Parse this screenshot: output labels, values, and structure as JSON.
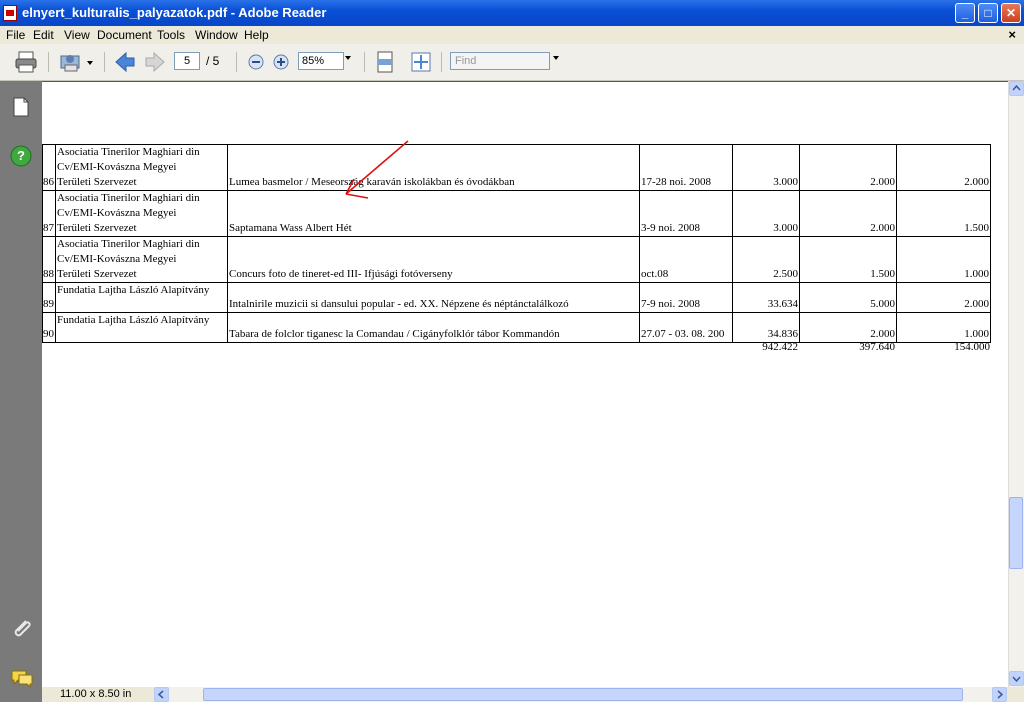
{
  "window": {
    "title": "elnyert_kulturalis_palyazatok.pdf - Adobe Reader",
    "minimize_label": "_",
    "maximize_label": "□",
    "close_label": "✕"
  },
  "menu": {
    "items": [
      "File",
      "Edit",
      "View",
      "Document",
      "Tools",
      "Window",
      "Help"
    ],
    "close_glyph": "×"
  },
  "toolbar": {
    "current_page": "5",
    "page_total": "/ 5",
    "zoom": "85%",
    "find_placeholder": "Find"
  },
  "table": {
    "rows": [
      {
        "idx": "86",
        "org": [
          "Asociatia Tinerilor Maghiari din",
          "Cv/EMI-Kovászna Megyei",
          "Területi Szervezet"
        ],
        "project": "Lumea basmelor / Meseország karaván iskolákban és óvodákban",
        "date": "17-28 noi. 2008",
        "v1": "3.000",
        "v2": "2.000",
        "v3": "2.000"
      },
      {
        "idx": "87",
        "org": [
          "Asociatia Tinerilor Maghiari din",
          "Cv/EMI-Kovászna Megyei",
          "Területi Szervezet"
        ],
        "project": "Saptamana Wass Albert Hét",
        "date": "3-9 noi. 2008",
        "v1": "3.000",
        "v2": "2.000",
        "v3": "1.500"
      },
      {
        "idx": "88",
        "org": [
          "Asociatia Tinerilor Maghiari din",
          "Cv/EMI-Kovászna Megyei",
          "Területi Szervezet"
        ],
        "project": "Concurs foto de tineret-ed III- Ifjúsági fotóverseny",
        "date": "oct.08",
        "v1": "2.500",
        "v2": "1.500",
        "v3": "1.000"
      },
      {
        "idx": "89",
        "org": [
          "Fundatia Lajtha László Alapítvány"
        ],
        "project": "Intalnirile muzicii si dansului popular - ed. XX. Népzene és néptánctalálkozó",
        "date": "7-9 noi. 2008",
        "v1": "33.634",
        "v2": "5.000",
        "v3": "2.000"
      },
      {
        "idx": "90",
        "org": [
          "Fundatia Lajtha László Alapítvány"
        ],
        "project": "Tabara de folclor tiganesc la Comandau / Cigányfolklór tábor Kommandón",
        "date": "27.07 - 03. 08. 200",
        "v1": "34.836",
        "v2": "2.000",
        "v3": "1.000"
      }
    ],
    "totals": {
      "v1": "942.422",
      "v2": "397.640",
      "v3": "154.000"
    }
  },
  "status": {
    "page_size": "11.00 x 8.50 in"
  },
  "colors": {
    "titlebar": "#0a50d6",
    "annotation_arrow": "#e01010",
    "navpanel": "#7a7a7a"
  }
}
